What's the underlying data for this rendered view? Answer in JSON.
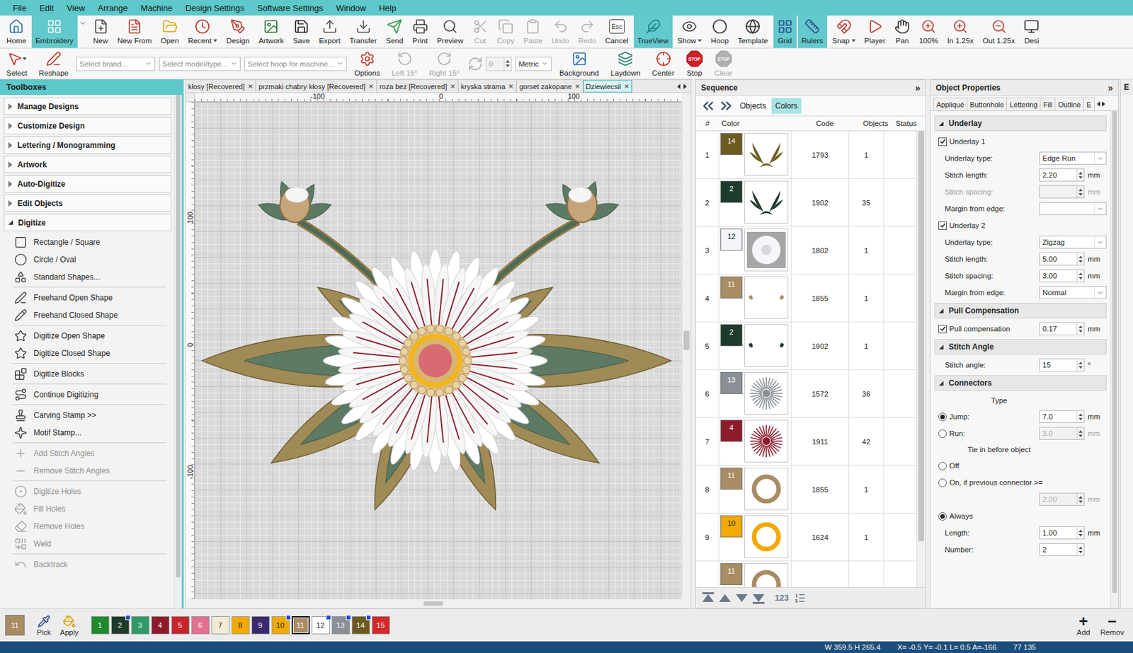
{
  "menu": [
    "File",
    "Edit",
    "View",
    "Arrange",
    "Machine",
    "Design Settings",
    "Software Settings",
    "Window",
    "Help"
  ],
  "toolbar": [
    {
      "label": "Home",
      "selected": false,
      "disabled": false,
      "dropdown": false
    },
    {
      "label": "Embroidery",
      "selected": true,
      "disabled": false,
      "dropdown": false
    },
    {
      "label": "New",
      "selected": false,
      "disabled": false,
      "dropdown": false
    },
    {
      "label": "New From",
      "selected": false,
      "disabled": false,
      "dropdown": false
    },
    {
      "label": "Open",
      "selected": false,
      "disabled": false,
      "dropdown": false
    },
    {
      "label": "Recent",
      "selected": false,
      "disabled": false,
      "dropdown": true
    },
    {
      "label": "Design",
      "selected": false,
      "disabled": false,
      "dropdown": false
    },
    {
      "label": "Artwork",
      "selected": false,
      "disabled": false,
      "dropdown": false
    },
    {
      "label": "Save",
      "selected": false,
      "disabled": false,
      "dropdown": false
    },
    {
      "label": "Export",
      "selected": false,
      "disabled": false,
      "dropdown": false
    },
    {
      "label": "Transfer",
      "selected": false,
      "disabled": false,
      "dropdown": false
    },
    {
      "label": "Send",
      "selected": false,
      "disabled": false,
      "dropdown": false
    },
    {
      "label": "Print",
      "selected": false,
      "disabled": false,
      "dropdown": false
    },
    {
      "label": "Preview",
      "selected": false,
      "disabled": false,
      "dropdown": false
    },
    {
      "label": "Cut",
      "selected": false,
      "disabled": true,
      "dropdown": false
    },
    {
      "label": "Copy",
      "selected": false,
      "disabled": true,
      "dropdown": false
    },
    {
      "label": "Paste",
      "selected": false,
      "disabled": true,
      "dropdown": false
    },
    {
      "label": "Undo",
      "selected": false,
      "disabled": true,
      "dropdown": false
    },
    {
      "label": "Redo",
      "selected": false,
      "disabled": true,
      "dropdown": false
    },
    {
      "label": "Cancel",
      "selected": false,
      "disabled": false,
      "dropdown": false,
      "icon_text": "Esc"
    },
    {
      "label": "TrueView",
      "selected": true,
      "disabled": false,
      "dropdown": false
    },
    {
      "label": "Show",
      "selected": false,
      "disabled": false,
      "dropdown": true
    },
    {
      "label": "Hoop",
      "selected": false,
      "disabled": false,
      "dropdown": false
    },
    {
      "label": "Template",
      "selected": false,
      "disabled": false,
      "dropdown": false
    },
    {
      "label": "Grid",
      "selected": true,
      "disabled": false,
      "dropdown": false
    },
    {
      "label": "Rulers",
      "selected": true,
      "disabled": false,
      "dropdown": false
    },
    {
      "label": "Snap",
      "selected": false,
      "disabled": false,
      "dropdown": true
    },
    {
      "label": "Player",
      "selected": false,
      "disabled": false,
      "dropdown": false
    },
    {
      "label": "Pan",
      "selected": false,
      "disabled": false,
      "dropdown": false
    },
    {
      "label": "100%",
      "selected": false,
      "disabled": false,
      "dropdown": false
    },
    {
      "label": "In 1.25x",
      "selected": false,
      "disabled": false,
      "dropdown": false
    },
    {
      "label": "Out 1.25x",
      "selected": false,
      "disabled": false,
      "dropdown": false
    },
    {
      "label": "Desi",
      "selected": false,
      "disabled": false,
      "dropdown": false
    }
  ],
  "toolbar2": [
    {
      "kind": "tool",
      "label": "Select",
      "disabled": false,
      "dropdown": true
    },
    {
      "kind": "tool",
      "label": "Reshape",
      "disabled": false,
      "dropdown": false
    },
    {
      "kind": "select",
      "placeholder": "Select brand..."
    },
    {
      "kind": "select",
      "placeholder": "Select model/type..."
    },
    {
      "kind": "select",
      "placeholder": "Select hoop for machine..."
    },
    {
      "kind": "tool",
      "label": "Options",
      "disabled": false,
      "dropdown": false
    },
    {
      "kind": "tool",
      "label": "Left 15°",
      "disabled": true,
      "dropdown": false
    },
    {
      "kind": "tool",
      "label": "Right 15°",
      "disabled": true,
      "dropdown": false
    },
    {
      "kind": "spin",
      "value": "0",
      "disabled": true
    },
    {
      "kind": "select",
      "value": "Metric"
    },
    {
      "kind": "tool",
      "label": "Background",
      "disabled": false,
      "dropdown": false
    },
    {
      "kind": "tool",
      "label": "Laydown",
      "disabled": false,
      "dropdown": false
    },
    {
      "kind": "tool",
      "label": "Center",
      "disabled": false,
      "dropdown": false
    },
    {
      "kind": "tool",
      "label": "Stop",
      "disabled": false,
      "dropdown": false,
      "icon_text": "STOP"
    },
    {
      "kind": "tool",
      "label": "Clear",
      "disabled": true,
      "dropdown": false,
      "icon_text": "STOP"
    }
  ],
  "toolboxes": {
    "title": "Toolboxes",
    "sections": [
      {
        "label": "Manage Designs",
        "expanded": false
      },
      {
        "label": "Customize Design",
        "expanded": false
      },
      {
        "label": "Lettering / Monogramming",
        "expanded": false
      },
      {
        "label": "Artwork",
        "expanded": false
      },
      {
        "label": "Auto-Digitize",
        "expanded": false
      },
      {
        "label": "Edit Objects",
        "expanded": false
      },
      {
        "label": "Digitize",
        "expanded": true
      }
    ],
    "items": [
      {
        "label": "Rectangle / Square",
        "disabled": false,
        "group": 1
      },
      {
        "label": "Circle / Oval",
        "disabled": false,
        "group": 1
      },
      {
        "label": "Standard Shapes...",
        "disabled": false,
        "group": 1
      },
      {
        "label": "Freehand Open Shape",
        "disabled": false,
        "group": 2
      },
      {
        "label": "Freehand Closed Shape",
        "disabled": false,
        "group": 2
      },
      {
        "label": "Digitize Open Shape",
        "disabled": false,
        "group": 3
      },
      {
        "label": "Digitize Closed Shape",
        "disabled": false,
        "group": 3
      },
      {
        "label": "Digitize Blocks",
        "disabled": false,
        "group": 4
      },
      {
        "label": "Continue Digitizing",
        "disabled": false,
        "group": 5
      },
      {
        "label": "Carving Stamp >>",
        "disabled": false,
        "group": 6
      },
      {
        "label": "Motif Stamp...",
        "disabled": false,
        "group": 6
      },
      {
        "label": "Add Stitch Angles",
        "disabled": true,
        "group": 7
      },
      {
        "label": "Remove Stitch Angles",
        "disabled": true,
        "group": 7
      },
      {
        "label": "Digitize Holes",
        "disabled": true,
        "group": 8
      },
      {
        "label": "Fill Holes",
        "disabled": true,
        "group": 8
      },
      {
        "label": "Remove Holes",
        "disabled": true,
        "group": 8
      },
      {
        "label": "Weld",
        "disabled": true,
        "group": 8
      },
      {
        "label": "Backtrack",
        "disabled": true,
        "group": 9
      }
    ],
    "scroll": {
      "level": 0,
      "size": 0.94
    }
  },
  "doc_tabs": [
    {
      "label": "kłosy [Recovered]",
      "selected": false,
      "close": "×"
    },
    {
      "label": "przmaki chabry kłosy [Recovered]",
      "selected": false,
      "close": "×"
    },
    {
      "label": "roza bez [Recovered]",
      "selected": false,
      "close": "×"
    },
    {
      "label": "kryska strama",
      "selected": false,
      "close": "×"
    },
    {
      "label": "gorset zakopane",
      "selected": false,
      "close": "×"
    },
    {
      "label": "Dziewiecsil",
      "selected": true,
      "close": "×"
    }
  ],
  "rulers": {
    "horizontal": [
      "-100",
      "0",
      "100"
    ],
    "vertical": [
      "100",
      "0",
      "-100"
    ]
  },
  "canvas_scroll": {
    "vertical": {
      "level": 0.46,
      "size": 0.04
    },
    "horizontal": {
      "level": 0.47,
      "size": 0.04
    }
  },
  "sequence": {
    "title": "Sequence",
    "collapse": "»",
    "tabs": [
      {
        "label": "Objects",
        "selected": false
      },
      {
        "label": "Colors",
        "selected": true
      }
    ],
    "columns": [
      "#",
      "Color",
      "Code",
      "Objects",
      "Status"
    ],
    "rows": [
      {
        "index": "1",
        "swatch": "14",
        "color": "#6c5b20",
        "code": "1793",
        "objects": "1"
      },
      {
        "index": "2",
        "swatch": "2",
        "color": "#1e3b2b",
        "code": "1902",
        "objects": "35"
      },
      {
        "index": "3",
        "swatch": "12",
        "color": "#f4f6f9",
        "code": "1802",
        "objects": "1"
      },
      {
        "index": "4",
        "swatch": "11",
        "color": "#a98c63",
        "code": "1855",
        "objects": "1"
      },
      {
        "index": "5",
        "swatch": "2",
        "color": "#1e3b2b",
        "code": "1902",
        "objects": "1"
      },
      {
        "index": "6",
        "swatch": "13",
        "color": "#8b9097",
        "code": "1572",
        "objects": "36"
      },
      {
        "index": "7",
        "swatch": "4",
        "color": "#8e1b2c",
        "code": "1911",
        "objects": "42"
      },
      {
        "index": "8",
        "swatch": "11",
        "color": "#a98c63",
        "code": "1855",
        "objects": "1"
      },
      {
        "index": "9",
        "swatch": "10",
        "color": "#f2a900",
        "code": "1624",
        "objects": "1"
      },
      {
        "index": "",
        "swatch": "11",
        "color": "#a98c63",
        "code": "",
        "objects": ""
      }
    ],
    "scroll": {
      "level": 0,
      "size": 0.9
    },
    "footer_label": "123"
  },
  "properties": {
    "title": "Object Properties",
    "collapse": "»",
    "tabs": [
      {
        "label": "Appliqué",
        "selected": false
      },
      {
        "label": "Buttonhole",
        "selected": false
      },
      {
        "label": "Lettering",
        "selected": false
      },
      {
        "label": "Fill",
        "selected": false
      },
      {
        "label": "Outline",
        "selected": false
      },
      {
        "label": "E",
        "selected": false
      }
    ],
    "rows": [
      {
        "kind": "section",
        "label": "Underlay",
        "expanded": true
      },
      {
        "kind": "check",
        "label": "Underlay 1",
        "checked": true
      },
      {
        "kind": "select",
        "label": "Underlay type:",
        "value": "Edge Run"
      },
      {
        "kind": "number",
        "label": "Stitch length:",
        "value": "2.20",
        "unit": "mm",
        "disabled": false,
        "label_disabled": false
      },
      {
        "kind": "number",
        "label": "Stitch spacing:",
        "value": "",
        "unit": "mm",
        "disabled": true,
        "label_disabled": true
      },
      {
        "kind": "select",
        "label": "Margin from edge:",
        "value": ""
      },
      {
        "kind": "check",
        "label": "Underlay 2",
        "checked": true
      },
      {
        "kind": "select",
        "label": "Underlay type:",
        "value": "Zigzag"
      },
      {
        "kind": "number",
        "label": "Stitch length:",
        "value": "5.00",
        "unit": "mm",
        "disabled": false,
        "label_disabled": false
      },
      {
        "kind": "number",
        "label": "Stitch spacing:",
        "value": "3.00",
        "unit": "mm",
        "disabled": false,
        "label_disabled": false
      },
      {
        "kind": "select",
        "label": "Margin from edge:",
        "value": "Normal"
      },
      {
        "kind": "section",
        "label": "Pull Compensation",
        "expanded": true
      },
      {
        "kind": "check_number",
        "label": "Pull compensation",
        "checked": true,
        "value": "0.17",
        "unit": "mm",
        "disabled": false
      },
      {
        "kind": "section",
        "label": "Stitch Angle",
        "expanded": true
      },
      {
        "kind": "number",
        "label": "Stitch angle:",
        "value": "15",
        "unit": "°",
        "disabled": false,
        "label_disabled": false
      },
      {
        "kind": "section",
        "label": "Connectors",
        "expanded": true
      },
      {
        "kind": "caption",
        "label": "Type"
      },
      {
        "kind": "radio_number",
        "label": "Jump:",
        "selected": true,
        "value": "7.0",
        "unit": "mm",
        "disabled": false
      },
      {
        "kind": "radio_number",
        "label": "Run:",
        "selected": false,
        "value": "3.0",
        "unit": "mm",
        "disabled": true
      },
      {
        "kind": "caption",
        "label": "Tie in before object"
      },
      {
        "kind": "radio",
        "label": "Off",
        "selected": false
      },
      {
        "kind": "radio",
        "label": "On, if previous connector >=",
        "selected": false
      },
      {
        "kind": "number",
        "label": "",
        "value": "2.00",
        "unit": "mm",
        "disabled": true,
        "label_disabled": false
      },
      {
        "kind": "radio",
        "label": "Always",
        "selected": true
      },
      {
        "kind": "number",
        "label": "Length:",
        "value": "1.00",
        "unit": "mm",
        "disabled": false,
        "label_disabled": false
      },
      {
        "kind": "number",
        "label": "Number:",
        "value": "2",
        "unit": "",
        "disabled": false,
        "label_disabled": false
      }
    ],
    "scroll": {
      "level": 0,
      "size": 0.97
    }
  },
  "extra_panel": {
    "title": "E"
  },
  "palette": {
    "current": {
      "label": "11",
      "color": "#a98c63"
    },
    "tools": [
      {
        "label": "Pick"
      },
      {
        "label": "Apply"
      }
    ],
    "swatches": [
      {
        "label": "1",
        "color": "#1f8a2e",
        "used": false,
        "selected": false
      },
      {
        "label": "2",
        "color": "#1e3b2b",
        "used": true,
        "selected": false
      },
      {
        "label": "3",
        "color": "#2f9a63",
        "used": false,
        "selected": false
      },
      {
        "label": "4",
        "color": "#8e1b2c",
        "used": false,
        "selected": false
      },
      {
        "label": "5",
        "color": "#c4262c",
        "used": false,
        "selected": false
      },
      {
        "label": "6",
        "color": "#e2708f",
        "used": false,
        "selected": false
      },
      {
        "label": "7",
        "color": "#f1ebd6",
        "used": false,
        "selected": false
      },
      {
        "label": "8",
        "color": "#f2a900",
        "used": false,
        "selected": false
      },
      {
        "label": "9",
        "color": "#3b2b6e",
        "used": false,
        "selected": false
      },
      {
        "label": "10",
        "color": "#f2a900",
        "used": true,
        "selected": false
      },
      {
        "label": "11",
        "color": "#a98c63",
        "used": false,
        "selected": true
      },
      {
        "label": "12",
        "color": "#ffffff",
        "used": true,
        "selected": false
      },
      {
        "label": "13",
        "color": "#8b9097",
        "used": true,
        "selected": false
      },
      {
        "label": "14",
        "color": "#6c5b20",
        "used": true,
        "selected": false
      },
      {
        "label": "15",
        "color": "#d3292b",
        "used": false,
        "selected": false
      }
    ],
    "actions": [
      {
        "label": "Add",
        "glyph": "+"
      },
      {
        "label": "Remov",
        "glyph": "−"
      }
    ]
  },
  "status": [
    "W 359.5 H 265.4",
    "X= -0.5 Y= -0.1 L= 0.5 A=-166",
    "77 135"
  ]
}
